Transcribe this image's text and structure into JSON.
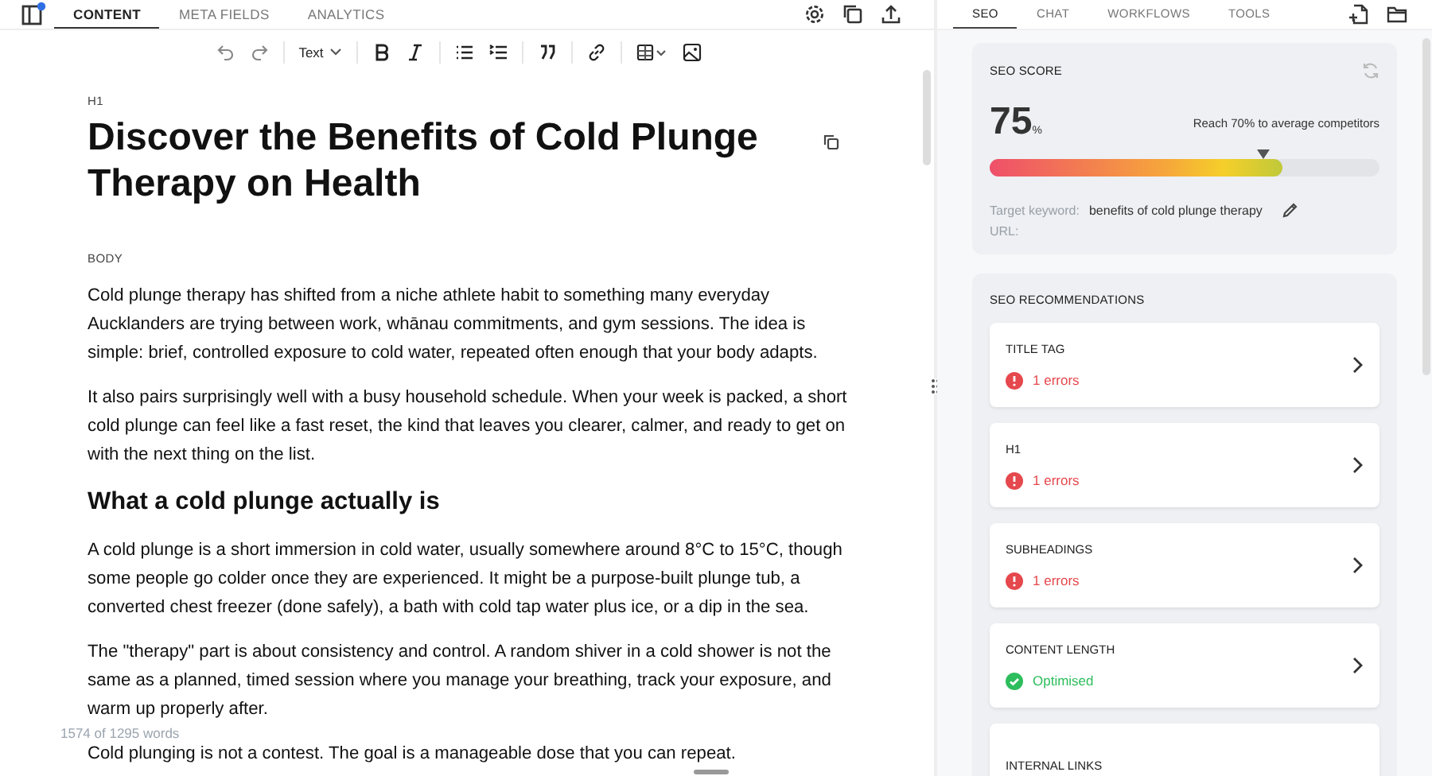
{
  "editor_tabs": [
    {
      "label": "CONTENT",
      "selected": true
    },
    {
      "label": "META FIELDS",
      "selected": false
    },
    {
      "label": "ANALYTICS",
      "selected": false
    }
  ],
  "toolbar": {
    "format": "Text"
  },
  "document": {
    "title_label": "H1",
    "title": "Discover the Benefits of Cold Plunge Therapy on Health",
    "body_label": "BODY",
    "blocks": [
      {
        "kind": "paragraph",
        "text": "Cold plunge therapy has shifted from a niche athlete habit to something many everyday Aucklanders are trying between work, whānau commitments, and gym sessions. The idea is simple: brief, controlled exposure to cold water, repeated often enough that your body adapts."
      },
      {
        "kind": "paragraph",
        "text": "It also pairs surprisingly well with a busy household schedule. When your week is packed, a short cold plunge can feel like a fast reset, the kind that leaves you clearer, calmer, and ready to get on with the next thing on the list."
      },
      {
        "kind": "heading",
        "text": "What a cold plunge actually is"
      },
      {
        "kind": "paragraph",
        "text": "A cold plunge is a short immersion in cold water, usually somewhere around 8°C to 15°C, though some people go colder once they are experienced. It might be a purpose-built plunge tub, a converted chest freezer (done safely), a bath with cold tap water plus ice, or a dip in the sea."
      },
      {
        "kind": "paragraph",
        "text": "The \"therapy\" part is about consistency and control. A random shiver in a cold shower is not the same as a planned, timed session where you manage your breathing, track your exposure, and warm up properly after."
      },
      {
        "kind": "paragraph",
        "text": "Cold plunging is not a contest. The goal is a manageable dose that you can repeat."
      }
    ],
    "word_count": "1574 of 1295 words"
  },
  "side_tabs": [
    {
      "label": "SEO",
      "selected": true
    },
    {
      "label": "CHAT",
      "selected": false
    },
    {
      "label": "WORKFLOWS",
      "selected": false
    },
    {
      "label": "TOOLS",
      "selected": false
    }
  ],
  "seo_score": {
    "title": "SEO SCORE",
    "score": "75",
    "unit": "%",
    "hint": "Reach 70% to average competitors",
    "level": 0.75,
    "marker": {
      "level": 0.7
    },
    "keyword_label": "Target keyword:",
    "keyword": "benefits of cold plunge therapy",
    "url_label": "URL:"
  },
  "recommendations": {
    "title": "SEO RECOMMENDATIONS",
    "items": [
      {
        "title": "TITLE TAG",
        "kind": "error",
        "status": "1 errors"
      },
      {
        "title": "H1",
        "kind": "error",
        "status": "1 errors"
      },
      {
        "title": "SUBHEADINGS",
        "kind": "error",
        "status": "1 errors"
      },
      {
        "title": "CONTENT LENGTH",
        "kind": "ok",
        "status": "Optimised"
      },
      {
        "title": "INTERNAL LINKS"
      }
    ]
  }
}
